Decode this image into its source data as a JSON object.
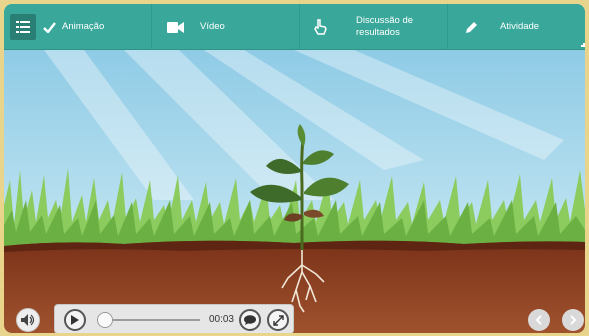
{
  "nav": {
    "items": [
      {
        "label": "Animação",
        "icon": "checkmark-icon",
        "menu_icon": "list-menu-icon"
      },
      {
        "label": "Vídeo",
        "icon": "video-camera-icon"
      },
      {
        "label_line1": "Discussão de",
        "label_line2": "resultados",
        "icon": "hand-pointer-icon"
      },
      {
        "label": "Atividade",
        "icon": "pencil-icon"
      }
    ]
  },
  "player": {
    "time": "00:03",
    "progress_fraction": 0.0,
    "volume_icon": "speaker-icon",
    "play_icon": "play-icon",
    "captions_icon": "speech-bubble-icon",
    "fullscreen_icon": "expand-icon",
    "prev_icon": "chevron-left-icon",
    "next_icon": "chevron-right-icon"
  },
  "colors": {
    "nav_bg": "#39a89a",
    "sky": "#a7d9ea",
    "grass": "#86c255",
    "soil": "#8b3f23"
  }
}
